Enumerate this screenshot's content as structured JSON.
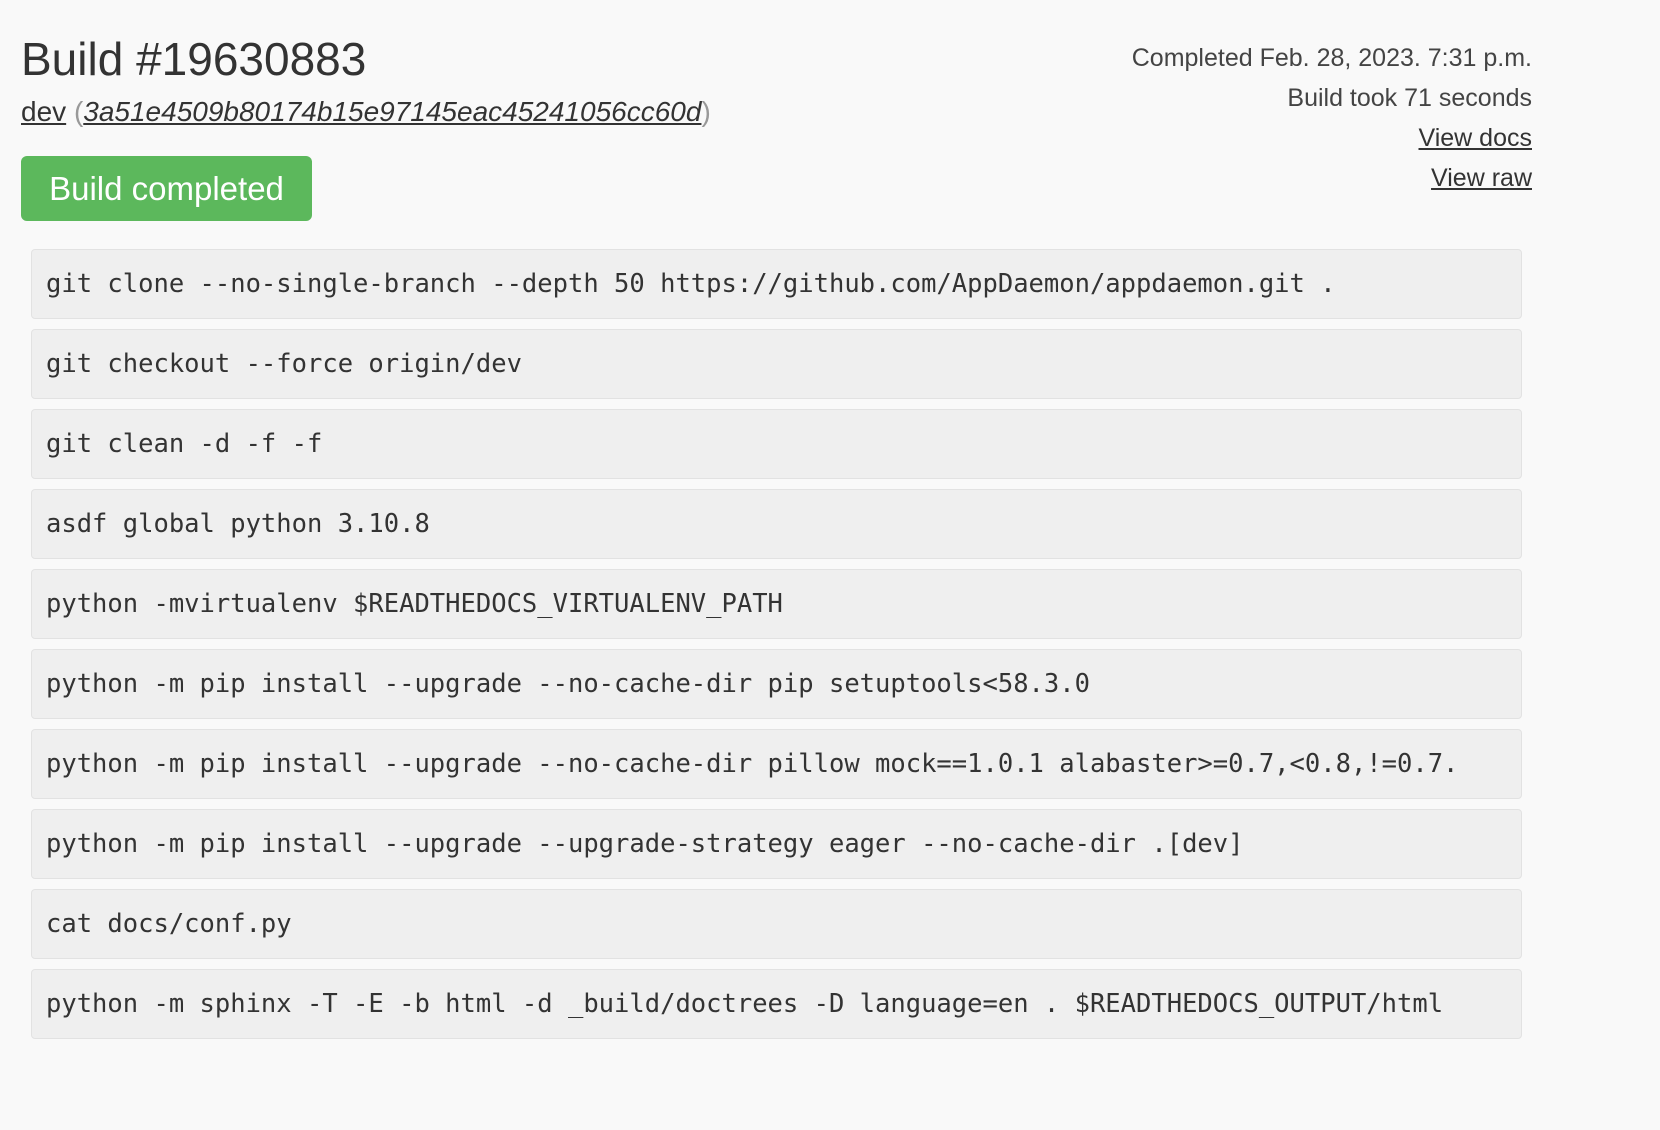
{
  "build": {
    "title": "Build #19630883",
    "branch": "dev",
    "paren_open": "(",
    "commit": "3a51e4509b80174b15e97145eac45241056cc60d",
    "paren_close": ")",
    "status": "Build completed"
  },
  "meta": {
    "completed": "Completed Feb. 28, 2023. 7:31 p.m.",
    "duration": "Build took 71 seconds",
    "view_docs": "View docs",
    "view_raw": "View raw"
  },
  "colors": {
    "success": "#5cb85c",
    "command_bg": "#efefef"
  },
  "commands": [
    "git clone --no-single-branch --depth 50 https://github.com/AppDaemon/appdaemon.git .",
    "git checkout --force origin/dev",
    "git clean -d -f -f",
    "asdf global python 3.10.8",
    "python -mvirtualenv $READTHEDOCS_VIRTUALENV_PATH",
    "python -m pip install --upgrade --no-cache-dir pip setuptools<58.3.0",
    "python -m pip install --upgrade --no-cache-dir pillow mock==1.0.1 alabaster>=0.7,<0.8,!=0.7.",
    "python -m pip install --upgrade --upgrade-strategy eager --no-cache-dir .[dev]",
    "cat docs/conf.py",
    "python -m sphinx -T -E -b html -d _build/doctrees -D language=en . $READTHEDOCS_OUTPUT/html"
  ]
}
